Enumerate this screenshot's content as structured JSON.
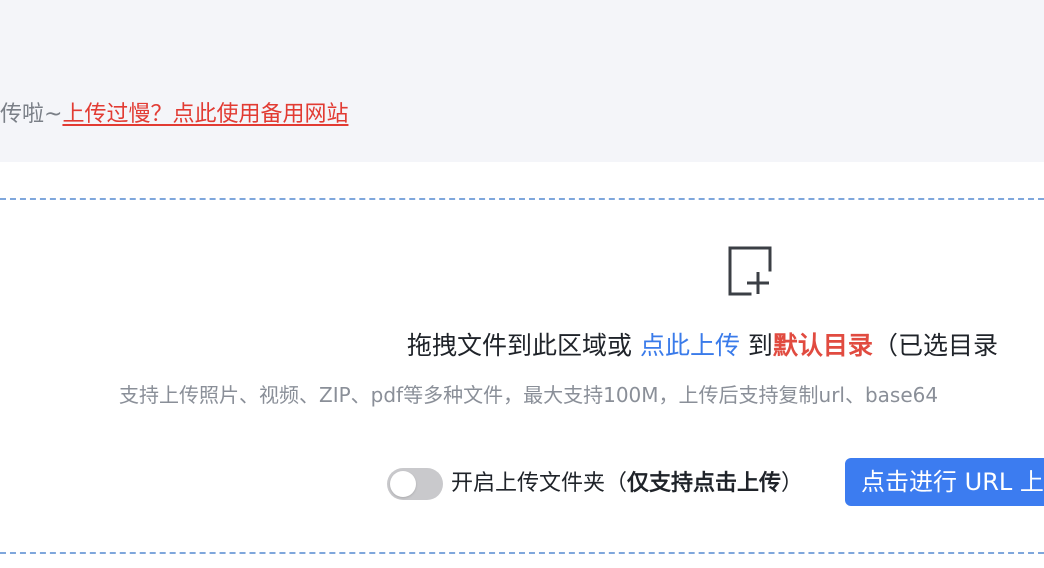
{
  "notice": {
    "prefix": "传啦~",
    "link": "上传过慢？点此使用备用网站"
  },
  "upload": {
    "icon": "add-file-icon",
    "drag_text": "拖拽文件到此区域或 ",
    "click_link": "点此上传",
    "to_text": " 到",
    "default_dir": "默认目录",
    "selected_dir_prefix": "（已选目录",
    "support_text": "支持上传照片、视频、ZIP、pdf等多种文件，最大支持100M，上传后支持复制url、base64"
  },
  "folder_toggle": {
    "state": "off",
    "label_prefix": "开启上传文件夹（",
    "label_bold": "仅支持点击上传",
    "label_suffix": "）"
  },
  "url_button": {
    "label": "点击进行 URL 上传"
  },
  "colors": {
    "accent": "#3c7cf0",
    "link_red": "#e23b33",
    "border_dashed": "#7fa7dc",
    "banner_bg": "#f4f5f9"
  }
}
